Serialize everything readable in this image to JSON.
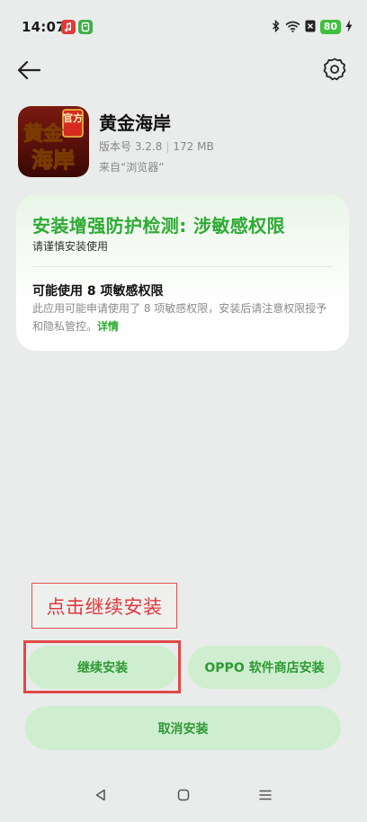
{
  "status_bar": {
    "time": "14:07",
    "battery": "80",
    "icons": [
      "bluetooth-icon",
      "wifi-icon",
      "sim-icon",
      "battery-icon",
      "charging-icon"
    ]
  },
  "header": {
    "back_icon": "arrow-left-icon",
    "settings_icon": "gear-icon"
  },
  "app": {
    "name": "黄金海岸",
    "version": "版本号 3.2.8",
    "size": "172 MB",
    "source": "来自“浏览器”",
    "icon_text_1": "官方",
    "icon_text_2": "黄金",
    "icon_text_3": "海岸"
  },
  "warning_card": {
    "title": "安装增强防护检测: 涉敏感权限",
    "subtitle": "请谨慎安装使用",
    "permission_title": "可能使用 8 项敏感权限",
    "permission_desc": "此应用可能申请使用了 8 项敏感权限，安装后请注意权限授予和隐私管控。",
    "details_link": "详情"
  },
  "hint": {
    "text": "点击继续安装"
  },
  "buttons": {
    "continue": "继续安装",
    "store": "OPPO 软件商店安装",
    "cancel": "取消安装"
  },
  "colors": {
    "accent_green": "#2eaa34",
    "button_bg": "#cfeed0",
    "hint_red": "#e03a3a",
    "background": "#e9ecea"
  }
}
